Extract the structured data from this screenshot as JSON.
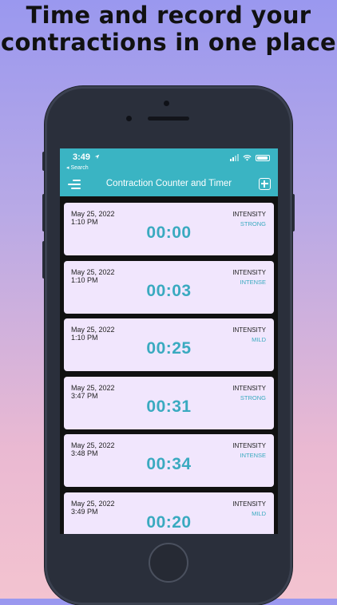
{
  "headline": "Time and record your contractions in one place",
  "status_bar": {
    "time": "3:49",
    "back_label": "◂ Search"
  },
  "navbar": {
    "title": "Contraction Counter and Timer"
  },
  "contractions": [
    {
      "date": "May 25, 2022",
      "time": "1:10 PM",
      "duration": "00:00",
      "intensity_label": "INTENSITY",
      "intensity": "STRONG"
    },
    {
      "date": "May 25, 2022",
      "time": "1:10 PM",
      "duration": "00:03",
      "intensity_label": "INTENSITY",
      "intensity": "INTENSE"
    },
    {
      "date": "May 25, 2022",
      "time": "1:10 PM",
      "duration": "00:25",
      "intensity_label": "INTENSITY",
      "intensity": "MILD"
    },
    {
      "date": "May 25, 2022",
      "time": "3:47 PM",
      "duration": "00:31",
      "intensity_label": "INTENSITY",
      "intensity": "STRONG"
    },
    {
      "date": "May 25, 2022",
      "time": "3:48 PM",
      "duration": "00:34",
      "intensity_label": "INTENSITY",
      "intensity": "INTENSE"
    },
    {
      "date": "May 25, 2022",
      "time": "3:49 PM",
      "duration": "00:20",
      "intensity_label": "INTENSITY",
      "intensity": "MILD"
    }
  ],
  "colors": {
    "accent": "#3ab4c3",
    "card_background": "#f1e6fd",
    "duration_text": "#3aaac0",
    "phone_body": "#2a2f3b"
  },
  "icons": {
    "menu": "menu-lines-icon",
    "add": "plus-square-icon",
    "location": "location-arrow-icon",
    "signal": "cellular-signal-icon",
    "wifi": "wifi-icon",
    "battery": "battery-icon"
  }
}
